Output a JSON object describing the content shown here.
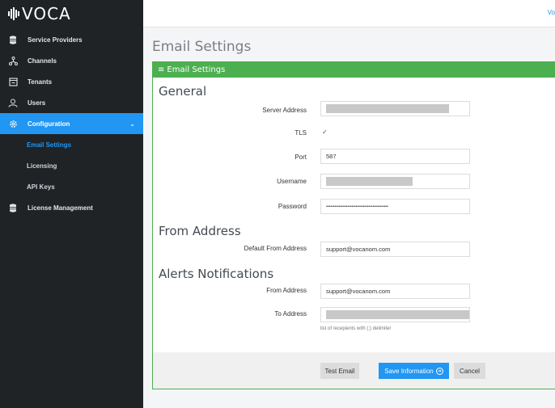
{
  "brand": {
    "logo_text": "VOCA"
  },
  "topbar": {
    "user_text": "Vo"
  },
  "sidebar": {
    "items": [
      {
        "label": "Service Providers",
        "icon": "database-icon"
      },
      {
        "label": "Channels",
        "icon": "network-icon"
      },
      {
        "label": "Tenants",
        "icon": "tenant-icon"
      },
      {
        "label": "Users",
        "icon": "users-icon"
      },
      {
        "label": "Configuration",
        "icon": "gear-icon",
        "active": true
      },
      {
        "label": "License Management",
        "icon": "database-icon"
      }
    ],
    "sub_items": [
      {
        "label": "Email Settings",
        "current": true
      },
      {
        "label": "Licensing"
      },
      {
        "label": "API Keys"
      }
    ],
    "chevron": "⌄"
  },
  "page": {
    "title": "Email Settings"
  },
  "panel": {
    "header": "Email Settings",
    "general": {
      "title": "General",
      "server_address_label": "Server Address",
      "server_address_value": "",
      "tls_label": "TLS",
      "tls_checked": true,
      "port_label": "Port",
      "port_value": "587",
      "username_label": "Username",
      "username_value": "",
      "password_label": "Password",
      "password_value": "••••••••••••••••••••••••••••••••••••••••••••"
    },
    "from_address": {
      "title": "From Address",
      "default_label": "Default From Address",
      "default_value": "support@vocanom.com"
    },
    "alerts": {
      "title": "Alerts Notifications",
      "from_label": "From Address",
      "from_value": "support@vocanom.com",
      "to_label": "To Address",
      "to_value": "",
      "to_hint": "list of recepients with (;) delimiter"
    },
    "buttons": {
      "test_email": "Test Email",
      "save": "Save Information",
      "cancel": "Cancel"
    }
  },
  "colors": {
    "accent": "#2196f3",
    "panel_header": "#4caf50",
    "sidebar": "#1f2326"
  }
}
